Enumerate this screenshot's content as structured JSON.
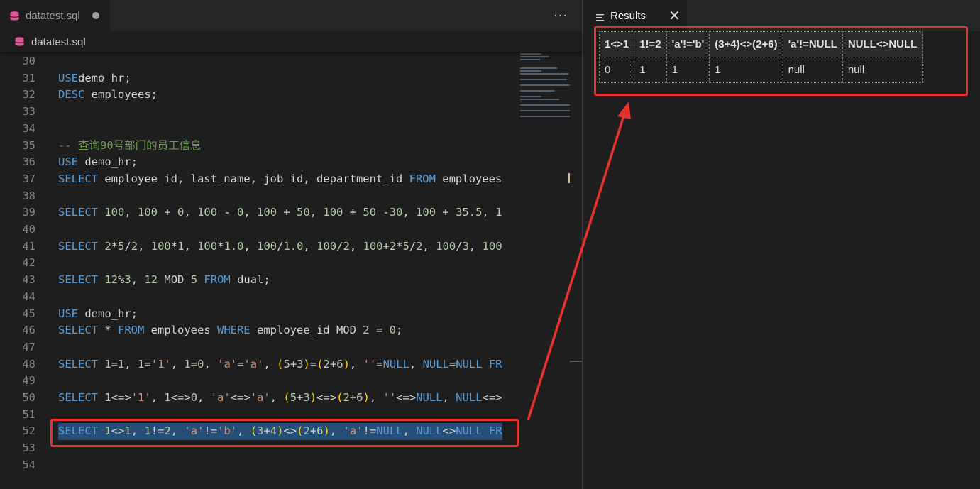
{
  "editor": {
    "tab_label": "datatest.sql",
    "breadcrumb_label": "datatest.sql",
    "more_actions": "···"
  },
  "code_lines": [
    {
      "ln": "30",
      "tokens": []
    },
    {
      "ln": "31",
      "tokens": [
        [
          "kw",
          "USE"
        ],
        [
          "",
          "demo_hr;"
        ]
      ]
    },
    {
      "ln": "32",
      "tokens": [
        [
          "kw",
          "DESC"
        ],
        [
          "",
          " employees;"
        ]
      ]
    },
    {
      "ln": "33",
      "tokens": []
    },
    {
      "ln": "34",
      "tokens": []
    },
    {
      "ln": "35",
      "tokens": [
        [
          "cmt",
          "-- 查询90号部门的员工信息"
        ]
      ]
    },
    {
      "ln": "36",
      "tokens": [
        [
          "kw",
          "USE"
        ],
        [
          "",
          " demo_hr;"
        ]
      ]
    },
    {
      "ln": "37",
      "tokens": [
        [
          "kw",
          "SELECT"
        ],
        [
          "",
          " employee_id, last_name, job_id, department_id "
        ],
        [
          "kw",
          "FROM"
        ],
        [
          "",
          " employees"
        ]
      ]
    },
    {
      "ln": "38",
      "tokens": []
    },
    {
      "ln": "39",
      "tokens": [
        [
          "kw",
          "SELECT"
        ],
        [
          "",
          " "
        ],
        [
          "num",
          "100"
        ],
        [
          ", "
        ],
        [
          "num",
          "100"
        ],
        [
          "",
          " + "
        ],
        [
          "num",
          "0"
        ],
        [
          ", "
        ],
        [
          "num",
          "100"
        ],
        [
          "",
          " - "
        ],
        [
          "num",
          "0"
        ],
        [
          ", "
        ],
        [
          "num",
          "100"
        ],
        [
          "",
          " + "
        ],
        [
          "num",
          "50"
        ],
        [
          ", "
        ],
        [
          "num",
          "100"
        ],
        [
          "",
          " + "
        ],
        [
          "num",
          "50"
        ],
        [
          "",
          " -"
        ],
        [
          "num",
          "30"
        ],
        [
          ", "
        ],
        [
          "num",
          "100"
        ],
        [
          "",
          " + "
        ],
        [
          "num",
          "35.5"
        ],
        [
          ", "
        ],
        [
          "num",
          "1"
        ]
      ]
    },
    {
      "ln": "40",
      "tokens": []
    },
    {
      "ln": "41",
      "tokens": [
        [
          "kw",
          "SELECT"
        ],
        [
          "",
          " "
        ],
        [
          "num",
          "2"
        ],
        [
          "",
          "*"
        ],
        [
          "num",
          "5"
        ],
        [
          "",
          "/"
        ],
        [
          "num",
          "2"
        ],
        [
          ", "
        ],
        [
          "num",
          "100"
        ],
        [
          "",
          "*"
        ],
        [
          "num",
          "1"
        ],
        [
          ", "
        ],
        [
          "num",
          "100"
        ],
        [
          "",
          "*"
        ],
        [
          "num",
          "1.0"
        ],
        [
          ", "
        ],
        [
          "num",
          "100"
        ],
        [
          "",
          "/"
        ],
        [
          "num",
          "1.0"
        ],
        [
          ", "
        ],
        [
          "num",
          "100"
        ],
        [
          "",
          "/"
        ],
        [
          "num",
          "2"
        ],
        [
          ", "
        ],
        [
          "num",
          "100"
        ],
        [
          "",
          "+"
        ],
        [
          "num",
          "2"
        ],
        [
          "",
          "*"
        ],
        [
          "num",
          "5"
        ],
        [
          "",
          "/"
        ],
        [
          "num",
          "2"
        ],
        [
          ", "
        ],
        [
          "num",
          "100"
        ],
        [
          "",
          "/"
        ],
        [
          "num",
          "3"
        ],
        [
          ", "
        ],
        [
          "num",
          "100"
        ]
      ]
    },
    {
      "ln": "42",
      "tokens": []
    },
    {
      "ln": "43",
      "tokens": [
        [
          "kw",
          "SELECT"
        ],
        [
          "",
          " "
        ],
        [
          "num",
          "12"
        ],
        [
          "",
          "%"
        ],
        [
          "num",
          "3"
        ],
        [
          ", "
        ],
        [
          "num",
          "12"
        ],
        [
          "",
          " MOD "
        ],
        [
          "num",
          "5"
        ],
        [
          "",
          " "
        ],
        [
          "kw",
          "FROM"
        ],
        [
          "",
          " dual;"
        ]
      ]
    },
    {
      "ln": "44",
      "tokens": []
    },
    {
      "ln": "45",
      "tokens": [
        [
          "kw",
          "USE"
        ],
        [
          "",
          " demo_hr;"
        ]
      ]
    },
    {
      "ln": "46",
      "tokens": [
        [
          "kw",
          "SELECT"
        ],
        [
          "",
          " * "
        ],
        [
          "kw",
          "FROM"
        ],
        [
          "",
          " employees "
        ],
        [
          "kw",
          "WHERE"
        ],
        [
          "",
          " employee_id MOD "
        ],
        [
          "num",
          "2"
        ],
        [
          "",
          " = "
        ],
        [
          "num",
          "0"
        ],
        [
          "",
          ";"
        ]
      ]
    },
    {
      "ln": "47",
      "tokens": []
    },
    {
      "ln": "48",
      "tokens": [
        [
          "kw",
          "SELECT"
        ],
        [
          "",
          " "
        ],
        [
          "num",
          "1"
        ],
        [
          "",
          "="
        ],
        [
          "num",
          "1"
        ],
        [
          ", "
        ],
        [
          "num",
          "1"
        ],
        [
          "",
          "="
        ],
        [
          "str",
          "'1'"
        ],
        [
          ", "
        ],
        [
          "num",
          "1"
        ],
        [
          "",
          "="
        ],
        [
          "num",
          "0"
        ],
        [
          ", "
        ],
        [
          "str",
          "'a'"
        ],
        [
          "",
          "="
        ],
        [
          "str",
          "'a'"
        ],
        [
          ", "
        ],
        [
          "par",
          "("
        ],
        [
          "num",
          "5"
        ],
        [
          "",
          "+"
        ],
        [
          "num",
          "3"
        ],
        [
          "par",
          ")"
        ],
        [
          "",
          "="
        ],
        [
          "par",
          "("
        ],
        [
          "num",
          "2"
        ],
        [
          "",
          "+"
        ],
        [
          "num",
          "6"
        ],
        [
          "par",
          ")"
        ],
        [
          ", "
        ],
        [
          "str",
          "''"
        ],
        [
          "",
          "="
        ],
        [
          "kw",
          "NULL"
        ],
        [
          ", "
        ],
        [
          "kw",
          "NULL"
        ],
        [
          "",
          "="
        ],
        [
          "kw",
          "NULL"
        ],
        [
          "",
          " "
        ],
        [
          "kw",
          "FR"
        ]
      ]
    },
    {
      "ln": "49",
      "tokens": []
    },
    {
      "ln": "50",
      "tokens": [
        [
          "kw",
          "SELECT"
        ],
        [
          "",
          " "
        ],
        [
          "num",
          "1"
        ],
        [
          "",
          "<=>"
        ],
        [
          "str",
          "'1'"
        ],
        [
          ", "
        ],
        [
          "num",
          "1"
        ],
        [
          "",
          "<=>"
        ],
        [
          "num",
          "0"
        ],
        [
          ", "
        ],
        [
          "str",
          "'a'"
        ],
        [
          "",
          "<=>"
        ],
        [
          "str",
          "'a'"
        ],
        [
          ", "
        ],
        [
          "par",
          "("
        ],
        [
          "num",
          "5"
        ],
        [
          "",
          "+"
        ],
        [
          "num",
          "3"
        ],
        [
          "par",
          ")"
        ],
        [
          "",
          "<=>"
        ],
        [
          "par",
          "("
        ],
        [
          "num",
          "2"
        ],
        [
          "",
          "+"
        ],
        [
          "num",
          "6"
        ],
        [
          "par",
          ")"
        ],
        [
          ", "
        ],
        [
          "str",
          "''"
        ],
        [
          "",
          "<=>"
        ],
        [
          "kw",
          "NULL"
        ],
        [
          ", "
        ],
        [
          "kw",
          "NULL"
        ],
        [
          "",
          "<=>"
        ]
      ]
    },
    {
      "ln": "51",
      "tokens": []
    },
    {
      "ln": "52",
      "tokens": [
        [
          "kw",
          "SELECT"
        ],
        [
          "",
          " "
        ],
        [
          "num",
          "1"
        ],
        [
          "",
          "<>"
        ],
        [
          "num",
          "1"
        ],
        [
          ", "
        ],
        [
          "num",
          "1"
        ],
        [
          "",
          "!="
        ],
        [
          "num",
          "2"
        ],
        [
          ", "
        ],
        [
          "str",
          "'a'"
        ],
        [
          "",
          "!="
        ],
        [
          "str",
          "'b'"
        ],
        [
          ", "
        ],
        [
          "par",
          "("
        ],
        [
          "num",
          "3"
        ],
        [
          "",
          "+"
        ],
        [
          "num",
          "4"
        ],
        [
          "par",
          ")"
        ],
        [
          "",
          "<>"
        ],
        [
          "par",
          "("
        ],
        [
          "num",
          "2"
        ],
        [
          "",
          "+"
        ],
        [
          "num",
          "6"
        ],
        [
          "par",
          ")"
        ],
        [
          ", "
        ],
        [
          "str",
          "'a'"
        ],
        [
          "",
          "!="
        ],
        [
          "kw",
          "NULL"
        ],
        [
          ", "
        ],
        [
          "kw",
          "NULL"
        ],
        [
          "",
          "<>"
        ],
        [
          "kw",
          "NULL"
        ],
        [
          "",
          " "
        ],
        [
          "kw",
          "FR"
        ]
      ],
      "selected": true
    },
    {
      "ln": "53",
      "tokens": []
    },
    {
      "ln": "54",
      "tokens": []
    }
  ],
  "results": {
    "tab_label": "Results",
    "close_glyph": "✕",
    "columns": [
      "1<>1",
      "1!=2",
      "'a'!='b'",
      "(3+4)<>(2+6)",
      "'a'!=NULL",
      "NULL<>NULL"
    ],
    "rows": [
      [
        "0",
        "1",
        "1",
        "1",
        "null",
        "null"
      ]
    ]
  },
  "colors": {
    "annotation": "#e5322d",
    "keyword": "#569cd6",
    "number": "#b5cea8",
    "string": "#ce9178",
    "comment": "#6a9955",
    "bracket": "#ffd700",
    "selection": "#264f78"
  },
  "icons": {
    "tab": "database-icon",
    "breadcrumb": "database-icon",
    "results_tab": "list-icon",
    "close": "close-icon",
    "more": "more-actions-icon"
  }
}
